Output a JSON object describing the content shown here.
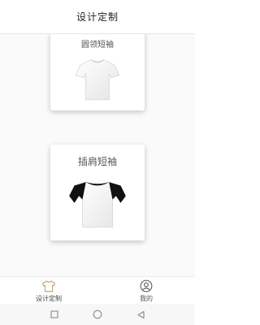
{
  "header": {
    "title": "设计定制"
  },
  "products": [
    {
      "label": "圆领短袖",
      "icon": "crew-neck-tshirt-icon"
    },
    {
      "label": "插肩短袖",
      "icon": "raglan-tshirt-icon"
    }
  ],
  "tabbar": {
    "items": [
      {
        "label": "设计定制",
        "icon": "tshirt-icon",
        "active": true
      },
      {
        "label": "我的",
        "icon": "user-icon",
        "active": false
      }
    ]
  },
  "system_nav": {
    "buttons": [
      "recent-apps-icon",
      "home-icon",
      "back-icon"
    ]
  },
  "colors": {
    "accent": "#c8a96e",
    "header_bg": "#ffffff",
    "content_bg": "#fafafa",
    "raglan_sleeve": "#111111"
  }
}
